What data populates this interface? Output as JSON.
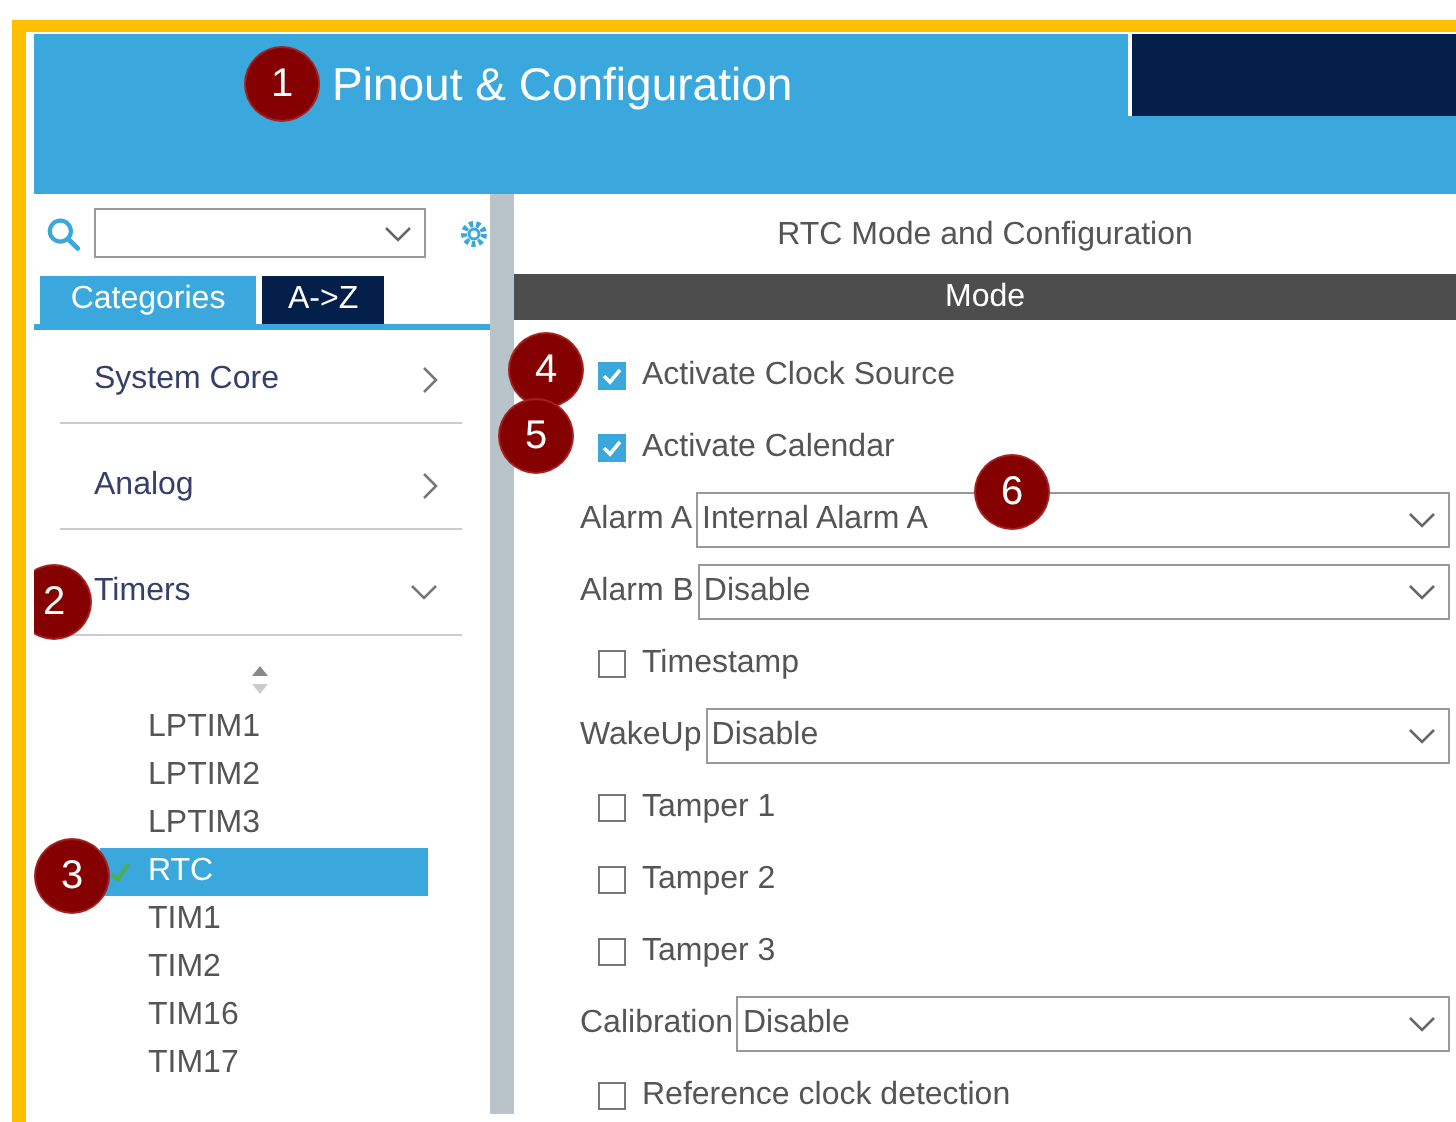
{
  "header": {
    "title": "Pinout & Configuration",
    "callout": "1"
  },
  "tabs": [
    {
      "label": "Categories",
      "selected": true
    },
    {
      "label": "A->Z",
      "selected": false
    }
  ],
  "categories": [
    {
      "label": "System Core",
      "expanded": false
    },
    {
      "label": "Analog",
      "expanded": false
    },
    {
      "label": "Timers",
      "expanded": true,
      "callout": "2",
      "children": [
        {
          "label": "LPTIM1",
          "selected": false,
          "checked": false
        },
        {
          "label": "LPTIM2",
          "selected": false,
          "checked": false
        },
        {
          "label": "LPTIM3",
          "selected": false,
          "checked": false
        },
        {
          "label": "RTC",
          "selected": true,
          "checked": true,
          "callout": "3"
        },
        {
          "label": "TIM1",
          "selected": false,
          "checked": false
        },
        {
          "label": "TIM2",
          "selected": false,
          "checked": false
        },
        {
          "label": "TIM16",
          "selected": false,
          "checked": false
        },
        {
          "label": "TIM17",
          "selected": false,
          "checked": false
        }
      ]
    }
  ],
  "panel": {
    "title": "RTC Mode and Configuration",
    "section": "Mode",
    "fields": [
      {
        "kind": "checkbox",
        "label": "Activate Clock Source",
        "checked": true,
        "callout": "4"
      },
      {
        "kind": "checkbox",
        "label": "Activate Calendar",
        "checked": true,
        "callout": "5"
      },
      {
        "kind": "select",
        "label": "Alarm A",
        "value": "Internal Alarm A",
        "callout": "6"
      },
      {
        "kind": "select",
        "label": "Alarm B",
        "value": "Disable"
      },
      {
        "kind": "checkbox",
        "label": "Timestamp",
        "checked": false
      },
      {
        "kind": "select",
        "label": "WakeUp",
        "value": "Disable"
      },
      {
        "kind": "checkbox",
        "label": "Tamper 1",
        "checked": false
      },
      {
        "kind": "checkbox",
        "label": "Tamper 2",
        "checked": false
      },
      {
        "kind": "checkbox",
        "label": "Tamper 3",
        "checked": false
      },
      {
        "kind": "select",
        "label": "Calibration",
        "value": "Disable"
      },
      {
        "kind": "checkbox",
        "label": "Reference clock detection",
        "checked": false
      }
    ]
  }
}
